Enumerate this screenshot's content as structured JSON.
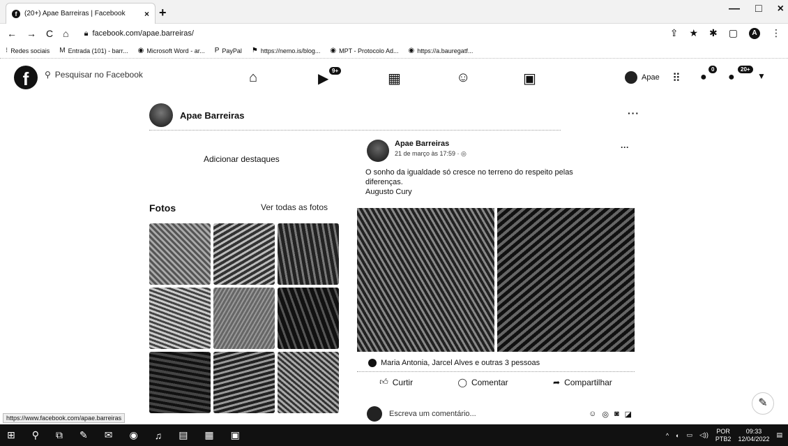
{
  "browser": {
    "tab_title": "(20+) Apae Barreiras | Facebook",
    "tab_close": "×",
    "new_tab": "+",
    "window_controls": [
      "—",
      "□",
      "×"
    ],
    "nav": [
      "←",
      "→",
      "C",
      "⌂"
    ],
    "url": "facebook.com/apae.barreiras/",
    "addr_right_icons": [
      "share-icon",
      "star-icon",
      "extensions-icon",
      "sidebar-icon"
    ],
    "profile_initial": "A",
    "menu": "⋮"
  },
  "bookmarks": [
    {
      "icon": "⁝",
      "label": "Redes sociais"
    },
    {
      "icon": "M",
      "label": "Entrada (101) - barr..."
    },
    {
      "icon": "◉",
      "label": "Microsoft Word - ar..."
    },
    {
      "icon": "P",
      "label": "PayPal"
    },
    {
      "icon": "⚑",
      "label": "https://nemo.is/blog..."
    },
    {
      "icon": "◉",
      "label": "MPT - Protocolo Ad..."
    },
    {
      "icon": "◉",
      "label": "https://a.bauregatf..."
    }
  ],
  "facebook": {
    "logo": "f",
    "search_placeholder": "Pesquisar no Facebook",
    "watch_badge": "9+",
    "account_name": "Apae",
    "messenger_badge": "0",
    "notif_badge": "20+"
  },
  "page": {
    "name": "Apae Barreiras",
    "more": "···",
    "add_highlights": "Adicionar destaques",
    "photos_title": "Fotos",
    "see_all_photos": "Ver todas as fotos"
  },
  "post": {
    "author": "Apae Barreiras",
    "time": "21 de março às 17:59 · ◎",
    "more": "···",
    "text_line1": "O sonho da igualdade só cresce no terreno do respeito pelas",
    "text_line2": "diferenças.",
    "text_line3": "Augusto Cury",
    "reactions": "Maria Antonia, Jarcel Alves e outras 3 pessoas",
    "like": "Curtir",
    "comment": "Comentar",
    "share": "Compartilhar",
    "comment_placeholder": "Escreva um comentário..."
  },
  "status_url": "https://www.facebook.com/apae.barreiras",
  "taskbar": {
    "lang": "POR",
    "lang2": "PTB2",
    "time": "09:33",
    "date": "12/04/2022"
  }
}
